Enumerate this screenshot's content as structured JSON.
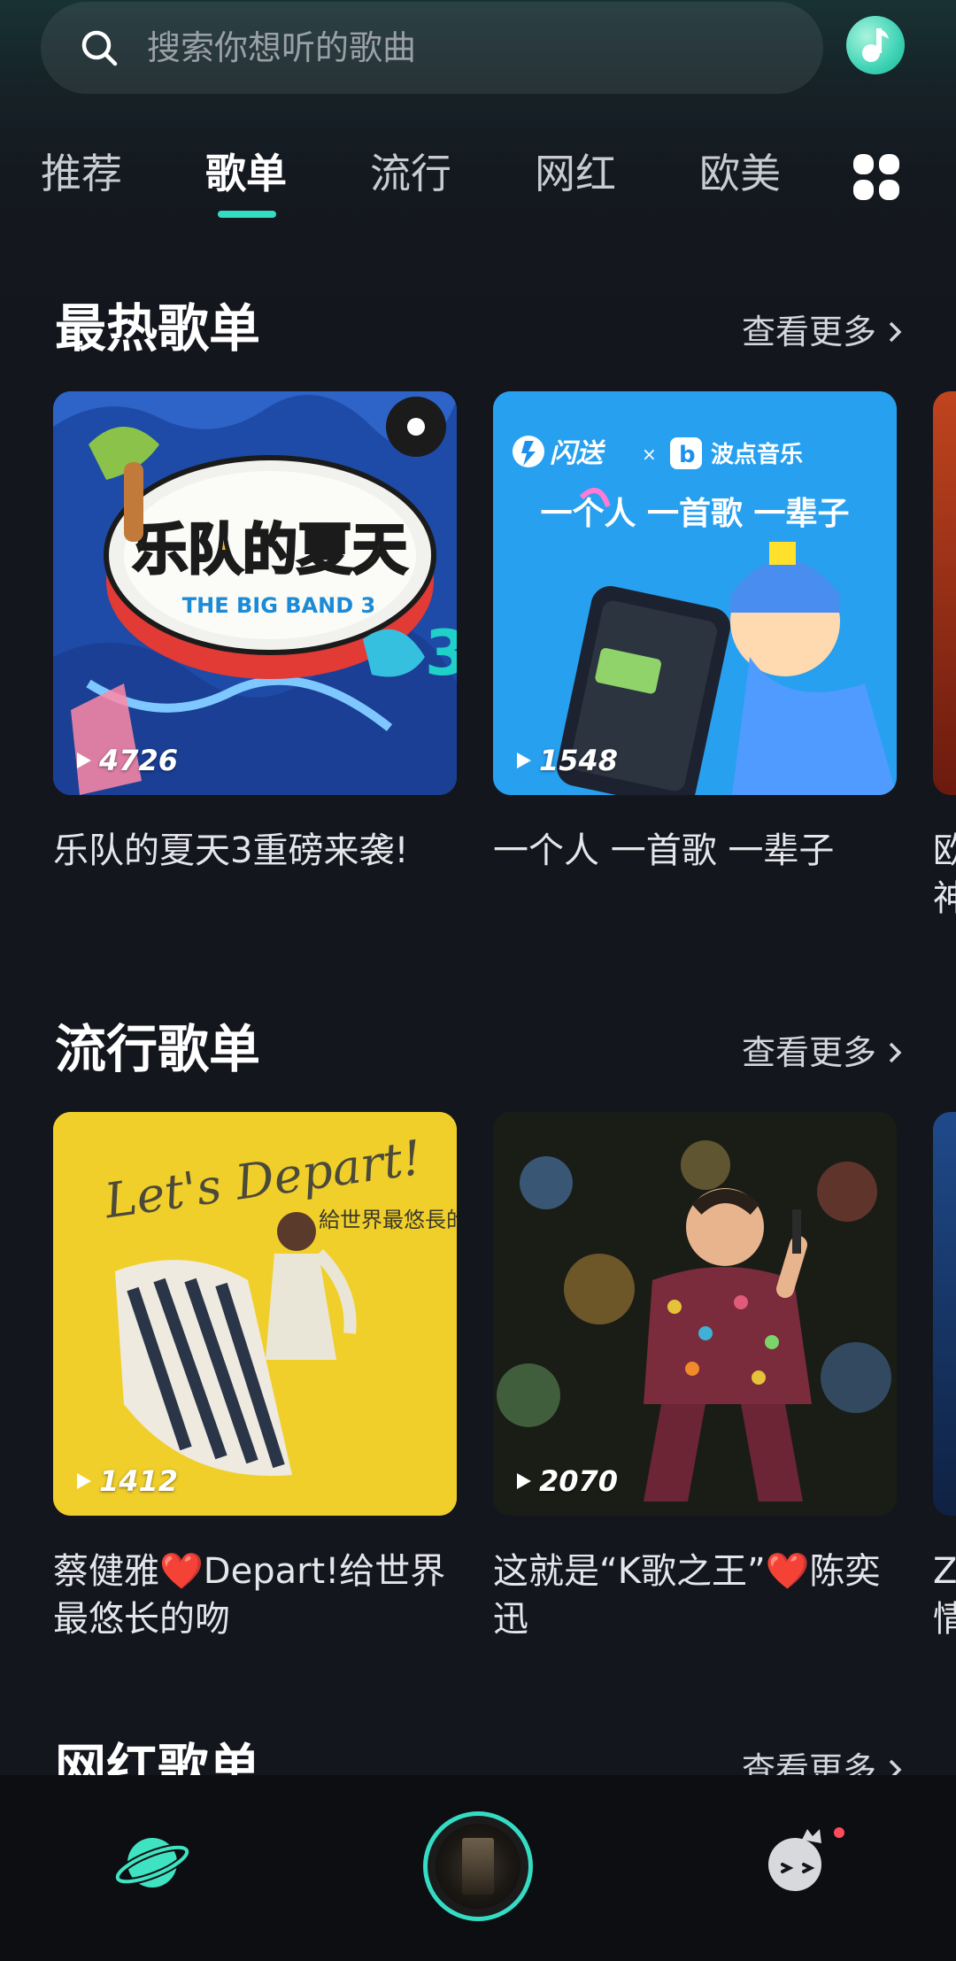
{
  "search": {
    "placeholder": "搜索你想听的歌曲"
  },
  "tabs": [
    {
      "label": "推荐"
    },
    {
      "label": "歌单"
    },
    {
      "label": "流行"
    },
    {
      "label": "网红"
    },
    {
      "label": "欧美"
    }
  ],
  "active_tab": "歌单",
  "sections": [
    {
      "title": "最热歌单",
      "see_more": "查看更多",
      "cards": [
        {
          "title": "乐队的夏天3重磅来袭!",
          "play_count": "4726",
          "cover_text": "乐队的夏天",
          "cover_sub": "THE BIG BAND 3"
        },
        {
          "title": "一个人 一首歌 一辈子",
          "play_count": "1548",
          "cover_brand_a": "闪送",
          "cover_brand_b": "波点音乐",
          "cover_slogan": "一个人 一首歌 一辈子"
        }
      ],
      "peek_text": [
        "欧",
        "神"
      ]
    },
    {
      "title": "流行歌单",
      "see_more": "查看更多",
      "cards": [
        {
          "title": "蔡健雅❤️Depart!给世界最悠长的吻",
          "play_count": "1412",
          "cover_text": "Let's Depart!",
          "cover_cn": "給世界最悠長的吻"
        },
        {
          "title": "这就是“K歌之王”❤️陈奕迅",
          "play_count": "2070"
        }
      ],
      "peek_text": [
        "Z",
        "情"
      ]
    },
    {
      "title": "网红歌单",
      "see_more": "查看更多"
    }
  ],
  "colors": {
    "accent": "#35dcc4",
    "background": "#14161d",
    "nav_background": "#0d0e12"
  },
  "bottom_nav": {
    "icons": [
      "planet-icon",
      "now-playing-disc",
      "mascot-icon"
    ]
  }
}
